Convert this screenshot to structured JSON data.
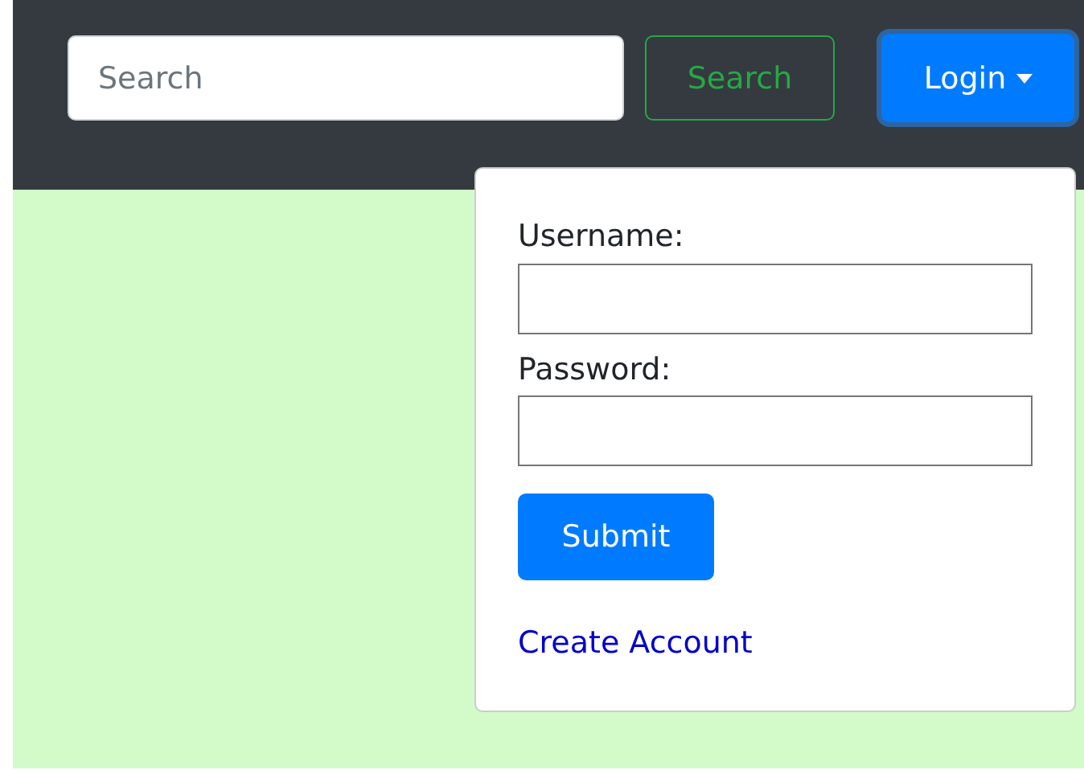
{
  "navbar": {
    "search": {
      "placeholder": "Search"
    },
    "search_button": "Search",
    "login_button": {
      "label": "Login",
      "expanded": true
    }
  },
  "login_menu": {
    "username_label": "Username:",
    "password_label": "Password:",
    "submit": "Submit",
    "create_account": "Create Account"
  }
}
